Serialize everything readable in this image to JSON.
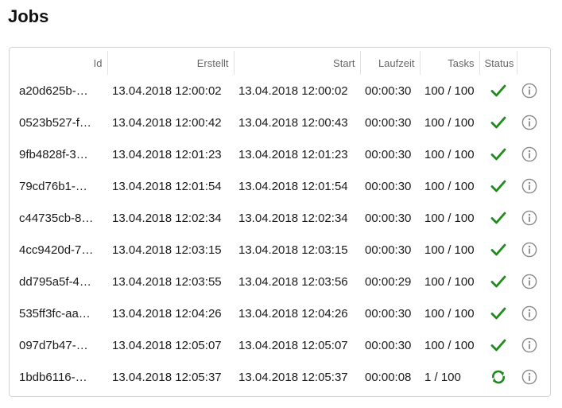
{
  "page": {
    "title": "Jobs"
  },
  "colors": {
    "success": "#1e8a1e",
    "running": "#1e8a1e",
    "info": "#8a8a8a"
  },
  "table": {
    "headers": {
      "id": "Id",
      "created": "Erstellt",
      "start": "Start",
      "duration": "Laufzeit",
      "tasks": "Tasks",
      "status": "Status",
      "info": ""
    },
    "rows": [
      {
        "id": "a20d625b-…",
        "created": "13.04.2018 12:00:02",
        "start": "13.04.2018 12:00:02",
        "duration": "00:00:30",
        "tasks": "100 / 100",
        "status": "done",
        "status_icon": "checkmark-icon",
        "info_icon": "info-icon"
      },
      {
        "id": "0523b527-f…",
        "created": "13.04.2018 12:00:42",
        "start": "13.04.2018 12:00:43",
        "duration": "00:00:30",
        "tasks": "100 / 100",
        "status": "done",
        "status_icon": "checkmark-icon",
        "info_icon": "info-icon"
      },
      {
        "id": "9fb4828f-3…",
        "created": "13.04.2018 12:01:23",
        "start": "13.04.2018 12:01:23",
        "duration": "00:00:30",
        "tasks": "100 / 100",
        "status": "done",
        "status_icon": "checkmark-icon",
        "info_icon": "info-icon"
      },
      {
        "id": "79cd76b1-…",
        "created": "13.04.2018 12:01:54",
        "start": "13.04.2018 12:01:54",
        "duration": "00:00:30",
        "tasks": "100 / 100",
        "status": "done",
        "status_icon": "checkmark-icon",
        "info_icon": "info-icon"
      },
      {
        "id": "c44735cb-8…",
        "created": "13.04.2018 12:02:34",
        "start": "13.04.2018 12:02:34",
        "duration": "00:00:30",
        "tasks": "100 / 100",
        "status": "done",
        "status_icon": "checkmark-icon",
        "info_icon": "info-icon"
      },
      {
        "id": "4cc9420d-7…",
        "created": "13.04.2018 12:03:15",
        "start": "13.04.2018 12:03:15",
        "duration": "00:00:30",
        "tasks": "100 / 100",
        "status": "done",
        "status_icon": "checkmark-icon",
        "info_icon": "info-icon"
      },
      {
        "id": "dd795a5f-4…",
        "created": "13.04.2018 12:03:55",
        "start": "13.04.2018 12:03:56",
        "duration": "00:00:29",
        "tasks": "100 / 100",
        "status": "done",
        "status_icon": "checkmark-icon",
        "info_icon": "info-icon"
      },
      {
        "id": "535ff3fc-aa…",
        "created": "13.04.2018 12:04:26",
        "start": "13.04.2018 12:04:26",
        "duration": "00:00:30",
        "tasks": "100 / 100",
        "status": "done",
        "status_icon": "checkmark-icon",
        "info_icon": "info-icon"
      },
      {
        "id": "097d7b47-…",
        "created": "13.04.2018 12:05:07",
        "start": "13.04.2018 12:05:07",
        "duration": "00:00:30",
        "tasks": "100 / 100",
        "status": "done",
        "status_icon": "checkmark-icon",
        "info_icon": "info-icon"
      },
      {
        "id": "1bdb6116-…",
        "created": "13.04.2018 12:05:37",
        "start": "13.04.2018 12:05:37",
        "duration": "00:00:08",
        "tasks": "1 / 100",
        "status": "running",
        "status_icon": "refresh-icon",
        "info_icon": "info-icon"
      }
    ]
  }
}
